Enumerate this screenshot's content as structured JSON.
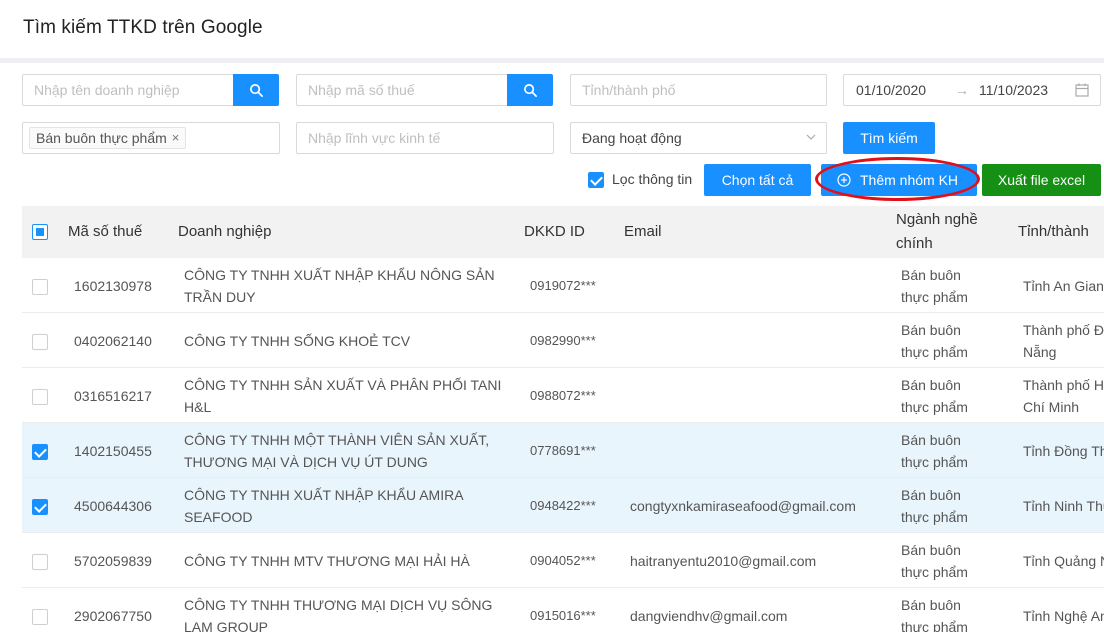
{
  "page": {
    "title": "Tìm kiếm TTKD trên Google"
  },
  "filters": {
    "company_name_placeholder": "Nhập tên doanh nghiệp",
    "tax_code_placeholder": "Nhập mã số thuế",
    "province_placeholder": "Tỉnh/thành phố",
    "date_from": "01/10/2020",
    "date_arrow": "→",
    "date_to": "11/10/2023",
    "industry_tag": "Bán buôn thực phẩm",
    "industry_tag_remove": "×",
    "field_placeholder": "Nhập lĩnh vực kinh tế",
    "status_value": "Đang hoạt động",
    "search_button": "Tìm kiếm"
  },
  "toolbar": {
    "filter_info_label": "Lọc thông tin",
    "filter_info_checked": true,
    "select_all_button": "Chọn tất cả",
    "add_group_button": "Thêm nhóm KH",
    "export_excel_button": "Xuất file excel"
  },
  "colors": {
    "primary": "#1890ff",
    "export": "#168f15",
    "highlight_ring": "#e0101b",
    "selected_row": "#e9f5fd"
  },
  "table": {
    "columns": {
      "tax_code": "Mã số thuế",
      "company": "Doanh nghiệp",
      "dkkd_id": "DKKD ID",
      "email": "Email",
      "industry_line1": "Ngành nghề",
      "industry_line2": "chính",
      "province": "Tỉnh/thành"
    },
    "rows": [
      {
        "checked": false,
        "tax_code": "1602130978",
        "name1": "CÔNG TY TNHH XUẤT NHẬP KHẨU NÔNG SẢN",
        "name2": "TRẦN DUY",
        "dkkd": "0919072***",
        "email": "",
        "ind1": "Bán buôn",
        "ind2": "thực phẩm",
        "prov1": "Tỉnh An Giang",
        "prov2": ""
      },
      {
        "checked": false,
        "tax_code": "0402062140",
        "name1": "CÔNG TY TNHH SỐNG KHOẺ TCV",
        "name2": "",
        "dkkd": "0982990***",
        "email": "",
        "ind1": "Bán buôn",
        "ind2": "thực phẩm",
        "prov1": "Thành phố Đà",
        "prov2": "Nẵng"
      },
      {
        "checked": false,
        "tax_code": "0316516217",
        "name1": "CÔNG TY TNHH SẢN XUẤT VÀ PHÂN PHỐI TANI",
        "name2": "H&L",
        "dkkd": "0988072***",
        "email": "",
        "ind1": "Bán buôn",
        "ind2": "thực phẩm",
        "prov1": "Thành phố Hồ",
        "prov2": "Chí Minh"
      },
      {
        "checked": true,
        "tax_code": "1402150455",
        "name1": "CÔNG TY TNHH MỘT THÀNH VIÊN SẢN XUẤT,",
        "name2": "THƯƠNG MẠI VÀ DỊCH VỤ ÚT DUNG",
        "dkkd": "0778691***",
        "email": "",
        "ind1": "Bán buôn",
        "ind2": "thực phẩm",
        "prov1": "Tỉnh Đồng Tháp",
        "prov2": ""
      },
      {
        "checked": true,
        "tax_code": "4500644306",
        "name1": "CÔNG TY TNHH XUẤT NHẬP KHẨU AMIRA",
        "name2": "SEAFOOD",
        "dkkd": "0948422***",
        "email": "congtyxnkamiraseafood@gmail.com",
        "ind1": "Bán buôn",
        "ind2": "thực phẩm",
        "prov1": "Tỉnh Ninh Thuận",
        "prov2": ""
      },
      {
        "checked": false,
        "tax_code": "5702059839",
        "name1": "CÔNG TY TNHH MTV THƯƠNG MẠI HẢI HÀ",
        "name2": "",
        "dkkd": "0904052***",
        "email": "haitranyentu2010@gmail.com",
        "ind1": "Bán buôn",
        "ind2": "thực phẩm",
        "prov1": "Tỉnh Quảng Ninh",
        "prov2": ""
      },
      {
        "checked": false,
        "tax_code": "2902067750",
        "name1": "CÔNG TY TNHH THƯƠNG MẠI DỊCH VỤ SÔNG",
        "name2": "LAM GROUP",
        "dkkd": "0915016***",
        "email": "dangviendhv@gmail.com",
        "ind1": "Bán buôn",
        "ind2": "thực phẩm",
        "prov1": "Tỉnh Nghệ An",
        "prov2": ""
      }
    ]
  }
}
